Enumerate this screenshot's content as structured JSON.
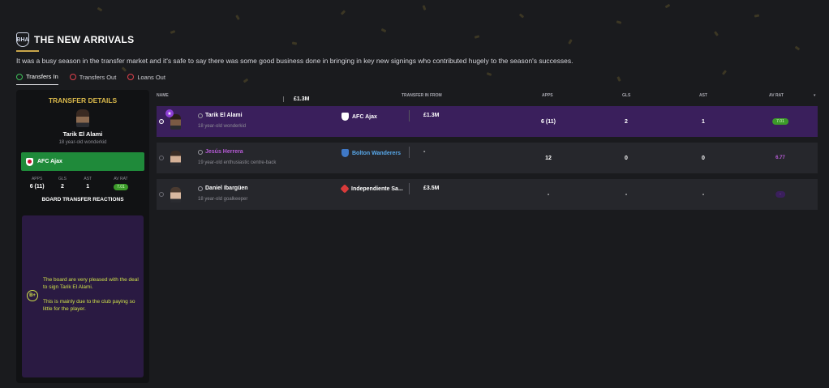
{
  "header": {
    "badge_text": "BHA",
    "title": "THE NEW ARRIVALS",
    "subtitle": "It was a busy season in the transfer market and it's safe to say there was some good business done in bringing in key new signings who contributed hugely to the season's successes."
  },
  "tabs": [
    {
      "label": "Transfers In",
      "icon": "transfer-in-icon",
      "active": true
    },
    {
      "label": "Transfers Out",
      "icon": "transfer-out-icon",
      "active": false
    },
    {
      "label": "Loans Out",
      "icon": "loan-out-icon",
      "active": false
    }
  ],
  "panel": {
    "title": "TRANSFER DETAILS",
    "player_name": "Tarik El Alami",
    "player_desc": "18 year-old wonderkid",
    "club": "AFC Ajax",
    "fee": "£1.3M",
    "stats": {
      "apps_label": "APPS",
      "apps": "6 (11)",
      "gls_label": "GLS",
      "gls": "2",
      "ast_label": "AST",
      "ast": "1",
      "rat_label": "AV RAT",
      "rat": "7.01"
    },
    "reactions_title": "BOARD TRANSFER REACTIONS",
    "grade": "B+",
    "reaction_line1": "The board are very pleased with the deal to sign Tarik El Alami.",
    "reaction_line2": "This is mainly due to the club paying so little for the player."
  },
  "table": {
    "headers": {
      "name": "NAME",
      "from": "TRANSFER IN FROM",
      "apps": "APPS",
      "gls": "GLS",
      "ast": "AST",
      "rat": "AV RAT"
    },
    "rows": [
      {
        "name": "Tarik El Alami",
        "desc": "18 year-old wonderkid",
        "club": "AFC Ajax",
        "fee": "£1.3M",
        "apps": "6 (11)",
        "gls": "2",
        "ast": "1",
        "rat": "7.01"
      },
      {
        "name": "Jesús Herrera",
        "desc": "19 year-old enthusiastic centre-back",
        "club": "Bolton Wanderers",
        "fee": "-",
        "apps": "12",
        "gls": "0",
        "ast": "0",
        "rat": "6.77"
      },
      {
        "name": "Daniel Ibargüen",
        "desc": "18 year-old goalkeeper",
        "club": "Independiente Sa...",
        "fee": "£3.5M",
        "apps": "-",
        "gls": "-",
        "ast": "-",
        "rat": "-"
      }
    ]
  },
  "colors": {
    "accent_gold": "#d9b84b",
    "selected_row": "#3a1f5c",
    "club_green": "#1f8a3a",
    "rating_green": "#3c9a2a",
    "grade_lime": "#cfe04a"
  }
}
